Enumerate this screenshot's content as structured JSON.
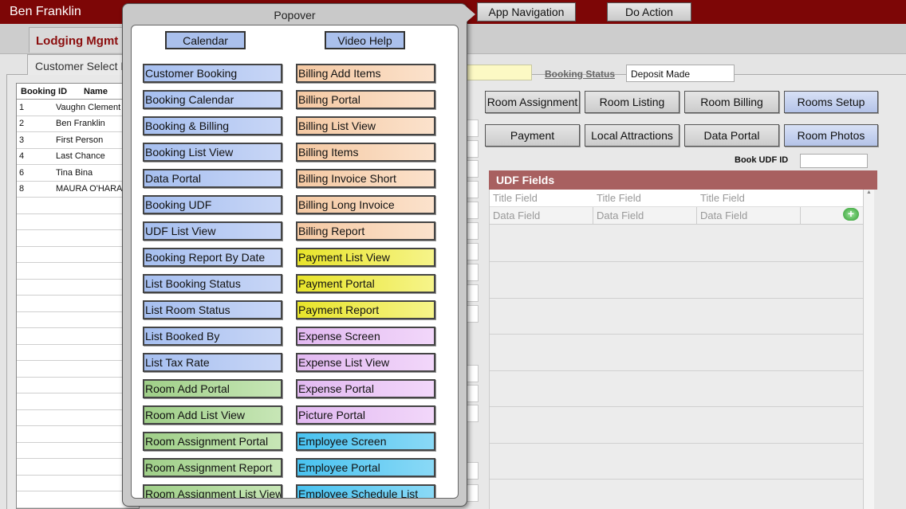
{
  "header": {
    "user_name": "Ben Franklin",
    "app_navigation": "App Navigation",
    "do_action": "Do Action"
  },
  "tabs": {
    "app_tab": "Lodging Mgmt",
    "sub_tab": "Customer Select P"
  },
  "customer_table": {
    "columns": [
      "Booking ID",
      "Name"
    ],
    "rows": [
      {
        "id": "1",
        "name": "Vaughn Clement"
      },
      {
        "id": "2",
        "name": "Ben Franklin"
      },
      {
        "id": "3",
        "name": "First Person"
      },
      {
        "id": "4",
        "name": "Last Chance"
      },
      {
        "id": "6",
        "name": "Tina Bina"
      },
      {
        "id": "8",
        "name": "MAURA O'HARA"
      }
    ]
  },
  "booking_status": {
    "label": "Booking Status",
    "value": "Deposit Made"
  },
  "nav_buttons": {
    "room_assignment": "Room Assignment",
    "room_listing": "Room Listing",
    "room_billing": "Room Billing",
    "rooms_setup": "Rooms Setup",
    "payment": "Payment",
    "local_attractions": "Local Attractions",
    "data_portal": "Data Portal",
    "room_photos": "Room Photos"
  },
  "udf": {
    "book_udf_id_label": "Book UDF ID",
    "header": "UDF Fields",
    "title_fields": [
      "Title Field",
      "Title Field",
      "Title Field"
    ],
    "data_fields": [
      "Data Field",
      "Data Field",
      "Data Field"
    ],
    "add_icon": "+"
  },
  "popover": {
    "title": "Popover",
    "calendar": "Calendar",
    "video_help": "Video Help",
    "left_items": [
      "Customer Booking",
      "Booking Calendar",
      "Booking & Billing",
      "Booking List View",
      "Data Portal",
      "Booking UDF",
      "UDF List View",
      "Booking Report By Date",
      "List Booking Status",
      "List Room Status",
      "List Booked By",
      "List Tax Rate",
      "Room Add Portal",
      "Room Add List View",
      "Room Assignment Portal",
      "Room Assignment Report",
      "Room Assignment List View"
    ],
    "right_items": [
      "Billing Add Items",
      "Billing Portal",
      "Billing List View",
      "Billing Items",
      "Billing Invoice Short",
      "Billing Long Invoice",
      "Billing Report",
      "Payment List View",
      "Payment Portal",
      "Payment Report",
      "Expense Screen",
      "Expense List View",
      "Expense Portal",
      "Picture Portal",
      "Employee Screen",
      "Employee Portal",
      "Employee Schedule List"
    ]
  },
  "colors": {
    "brand_bar": "#7d0606",
    "udf_header": "#a86060"
  }
}
